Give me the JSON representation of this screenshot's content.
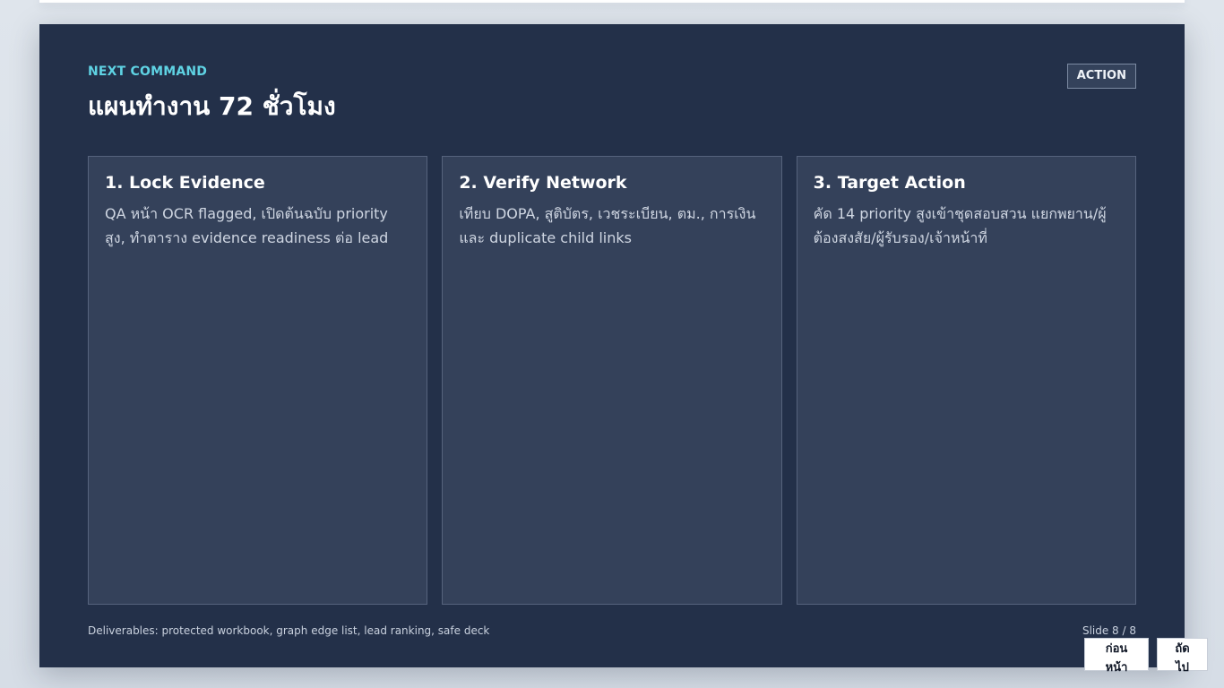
{
  "slide": {
    "eyebrow": "NEXT COMMAND",
    "title": "แผนทำงาน 72 ชั่วโมง",
    "badge": "ACTION",
    "cards": [
      {
        "title": "1. Lock Evidence",
        "text": "QA หน้า OCR flagged, เปิดต้นฉบับ priority สูง, ทำตาราง evidence readiness ต่อ lead"
      },
      {
        "title": "2. Verify Network",
        "text": "เทียบ DOPA, สูติบัตร, เวชระเบียน, ตม., การเงิน และ duplicate child links"
      },
      {
        "title": "3. Target Action",
        "text": "คัด 14 priority สูงเข้าชุดสอบสวน แยกพยาน/ผู้ต้องสงสัย/ผู้รับรอง/เจ้าหน้าที่"
      }
    ],
    "footer": "Deliverables: protected workbook, graph edge list, lead ranking, safe deck",
    "slide_number": "Slide 8 / 8"
  },
  "nav": {
    "prev_label": "ก่อนหน้า",
    "next_label": "ถัดไป"
  },
  "colors": {
    "slide_background": "#233049",
    "accent": "#5fd3e4",
    "card_background": "#34415a"
  }
}
